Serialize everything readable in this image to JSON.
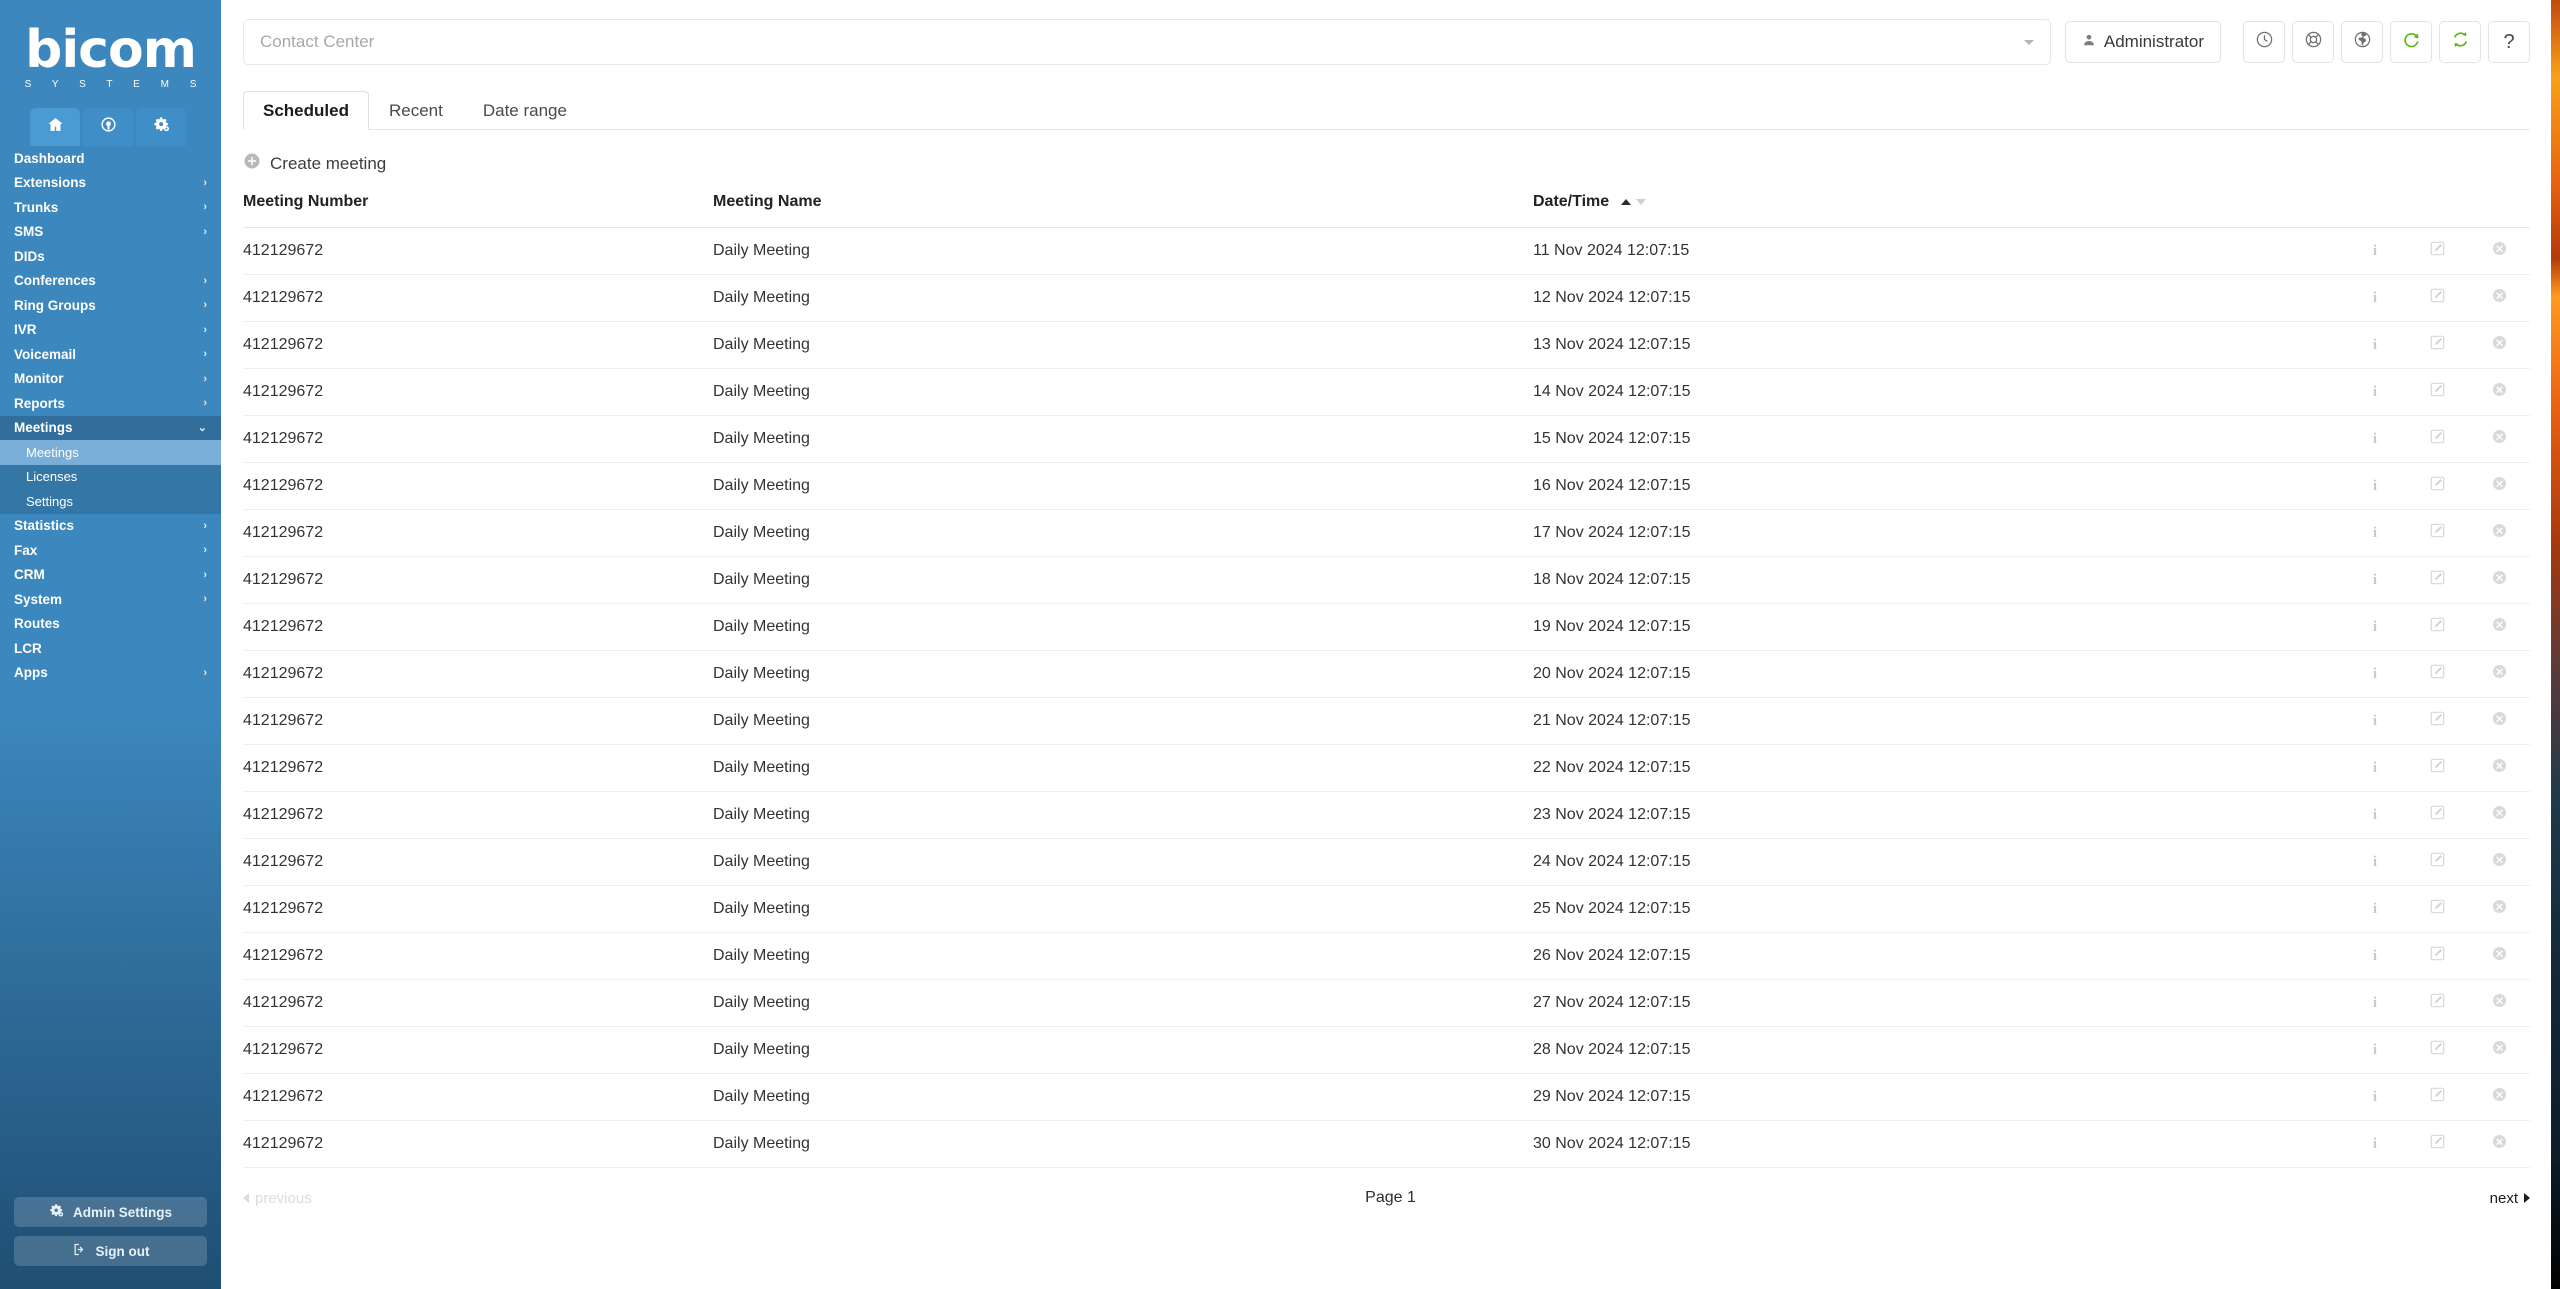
{
  "brand": {
    "word": "bicom",
    "sub": "S Y S T E M S"
  },
  "sidebar": {
    "mode_tabs": [
      {
        "name": "home",
        "icon": "home-icon",
        "active": true
      },
      {
        "name": "contact-center",
        "icon": "headset-icon",
        "active": false
      },
      {
        "name": "settings",
        "icon": "gears-icon",
        "active": false
      }
    ],
    "items": [
      {
        "label": "Dashboard",
        "expandable": false
      },
      {
        "label": "Extensions",
        "expandable": true
      },
      {
        "label": "Trunks",
        "expandable": true
      },
      {
        "label": "SMS",
        "expandable": true
      },
      {
        "label": "DIDs",
        "expandable": false
      },
      {
        "label": "Conferences",
        "expandable": true
      },
      {
        "label": "Ring Groups",
        "expandable": true
      },
      {
        "label": "IVR",
        "expandable": true
      },
      {
        "label": "Voicemail",
        "expandable": true
      },
      {
        "label": "Monitor",
        "expandable": true
      },
      {
        "label": "Reports",
        "expandable": true
      },
      {
        "label": "Meetings",
        "expandable": true,
        "expanded": true
      },
      {
        "label": "Statistics",
        "expandable": true
      },
      {
        "label": "Fax",
        "expandable": true
      },
      {
        "label": "CRM",
        "expandable": true
      },
      {
        "label": "System",
        "expandable": true
      },
      {
        "label": "Routes",
        "expandable": false
      },
      {
        "label": "LCR",
        "expandable": false
      },
      {
        "label": "Apps",
        "expandable": true
      }
    ],
    "meetings_sub": [
      {
        "label": "Meetings",
        "active": true
      },
      {
        "label": "Licenses",
        "active": false
      },
      {
        "label": "Settings",
        "active": false
      }
    ],
    "footer": {
      "admin_settings": "Admin Settings",
      "sign_out": "Sign out"
    },
    "colors": {
      "bg_top": "#3c87bd",
      "bg_bottom": "#1f4e73",
      "active_sub": "#78aed8"
    }
  },
  "topbar": {
    "search_placeholder": "Contact Center",
    "search_value": "",
    "user_label": "Administrator",
    "icons": [
      {
        "name": "clock-icon",
        "title": "clock"
      },
      {
        "name": "lifebuoy-icon",
        "title": "support"
      },
      {
        "name": "globe-icon",
        "title": "language"
      },
      {
        "name": "reload-icon",
        "title": "reload",
        "color": "#5cb811"
      },
      {
        "name": "sync-icon",
        "title": "sync",
        "color": "#5cb811"
      },
      {
        "name": "help-icon",
        "title": "help",
        "glyph": "?"
      }
    ]
  },
  "tabs": [
    {
      "label": "Scheduled",
      "active": true
    },
    {
      "label": "Recent",
      "active": false
    },
    {
      "label": "Date range",
      "active": false
    }
  ],
  "actions": {
    "create_meeting": "Create meeting"
  },
  "table": {
    "columns": [
      "Meeting Number",
      "Meeting Name",
      "Date/Time"
    ],
    "sort": {
      "column": "Date/Time",
      "direction": "asc"
    },
    "row_actions": [
      "info-icon",
      "edit-icon",
      "delete-icon"
    ],
    "rows": [
      {
        "number": "412129672",
        "name": "Daily Meeting",
        "datetime": "11 Nov 2024 12:07:15"
      },
      {
        "number": "412129672",
        "name": "Daily Meeting",
        "datetime": "12 Nov 2024 12:07:15"
      },
      {
        "number": "412129672",
        "name": "Daily Meeting",
        "datetime": "13 Nov 2024 12:07:15"
      },
      {
        "number": "412129672",
        "name": "Daily Meeting",
        "datetime": "14 Nov 2024 12:07:15"
      },
      {
        "number": "412129672",
        "name": "Daily Meeting",
        "datetime": "15 Nov 2024 12:07:15"
      },
      {
        "number": "412129672",
        "name": "Daily Meeting",
        "datetime": "16 Nov 2024 12:07:15"
      },
      {
        "number": "412129672",
        "name": "Daily Meeting",
        "datetime": "17 Nov 2024 12:07:15"
      },
      {
        "number": "412129672",
        "name": "Daily Meeting",
        "datetime": "18 Nov 2024 12:07:15"
      },
      {
        "number": "412129672",
        "name": "Daily Meeting",
        "datetime": "19 Nov 2024 12:07:15"
      },
      {
        "number": "412129672",
        "name": "Daily Meeting",
        "datetime": "20 Nov 2024 12:07:15"
      },
      {
        "number": "412129672",
        "name": "Daily Meeting",
        "datetime": "21 Nov 2024 12:07:15"
      },
      {
        "number": "412129672",
        "name": "Daily Meeting",
        "datetime": "22 Nov 2024 12:07:15"
      },
      {
        "number": "412129672",
        "name": "Daily Meeting",
        "datetime": "23 Nov 2024 12:07:15"
      },
      {
        "number": "412129672",
        "name": "Daily Meeting",
        "datetime": "24 Nov 2024 12:07:15"
      },
      {
        "number": "412129672",
        "name": "Daily Meeting",
        "datetime": "25 Nov 2024 12:07:15"
      },
      {
        "number": "412129672",
        "name": "Daily Meeting",
        "datetime": "26 Nov 2024 12:07:15"
      },
      {
        "number": "412129672",
        "name": "Daily Meeting",
        "datetime": "27 Nov 2024 12:07:15"
      },
      {
        "number": "412129672",
        "name": "Daily Meeting",
        "datetime": "28 Nov 2024 12:07:15"
      },
      {
        "number": "412129672",
        "name": "Daily Meeting",
        "datetime": "29 Nov 2024 12:07:15"
      },
      {
        "number": "412129672",
        "name": "Daily Meeting",
        "datetime": "30 Nov 2024 12:07:15"
      }
    ]
  },
  "pagination": {
    "previous": "previous",
    "page_label": "Page 1",
    "next": "next",
    "previous_disabled": true
  }
}
